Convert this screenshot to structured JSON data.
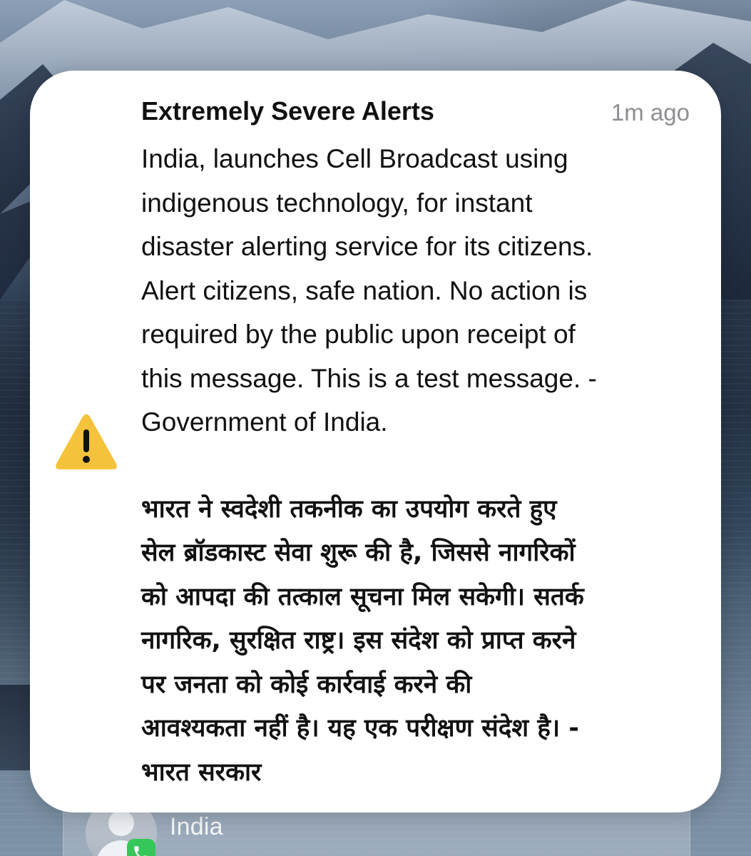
{
  "alert": {
    "title": "Extremely Severe Alerts",
    "time": "1m ago",
    "body_english": "India, launches Cell Broadcast using\nindigenous technology, for instant\ndisaster alerting service for its citizens.\nAlert citizens, safe nation. No action is\nrequired by the public upon receipt of\nthis message. This is a test message. -\nGovernment of India.",
    "body_hindi": "भारत ने स्वदेशी तकनीक का उपयोग करते हुए\nसेल ब्रॉडकास्ट सेवा शुरू की है, जिससे नागरिकों\nको आपदा की तत्काल सूचना मिल सकेगी। सतर्क\nनागरिक, सुरक्षित राष्ट्र। इस संदेश को प्राप्त करने\nपर जनता को कोई कार्रवाई करने की\nआवश्यकता नहीं है। यह एक परीक्षण संदेश है। -\nभारत सरकार",
    "icon": "warning-triangle-icon",
    "icon_color": "#f5c33b"
  },
  "background_notification": {
    "title": "India",
    "avatar_icon": "contact-avatar-icon",
    "badge_icon": "phone-icon",
    "badge_color": "#35c759"
  }
}
